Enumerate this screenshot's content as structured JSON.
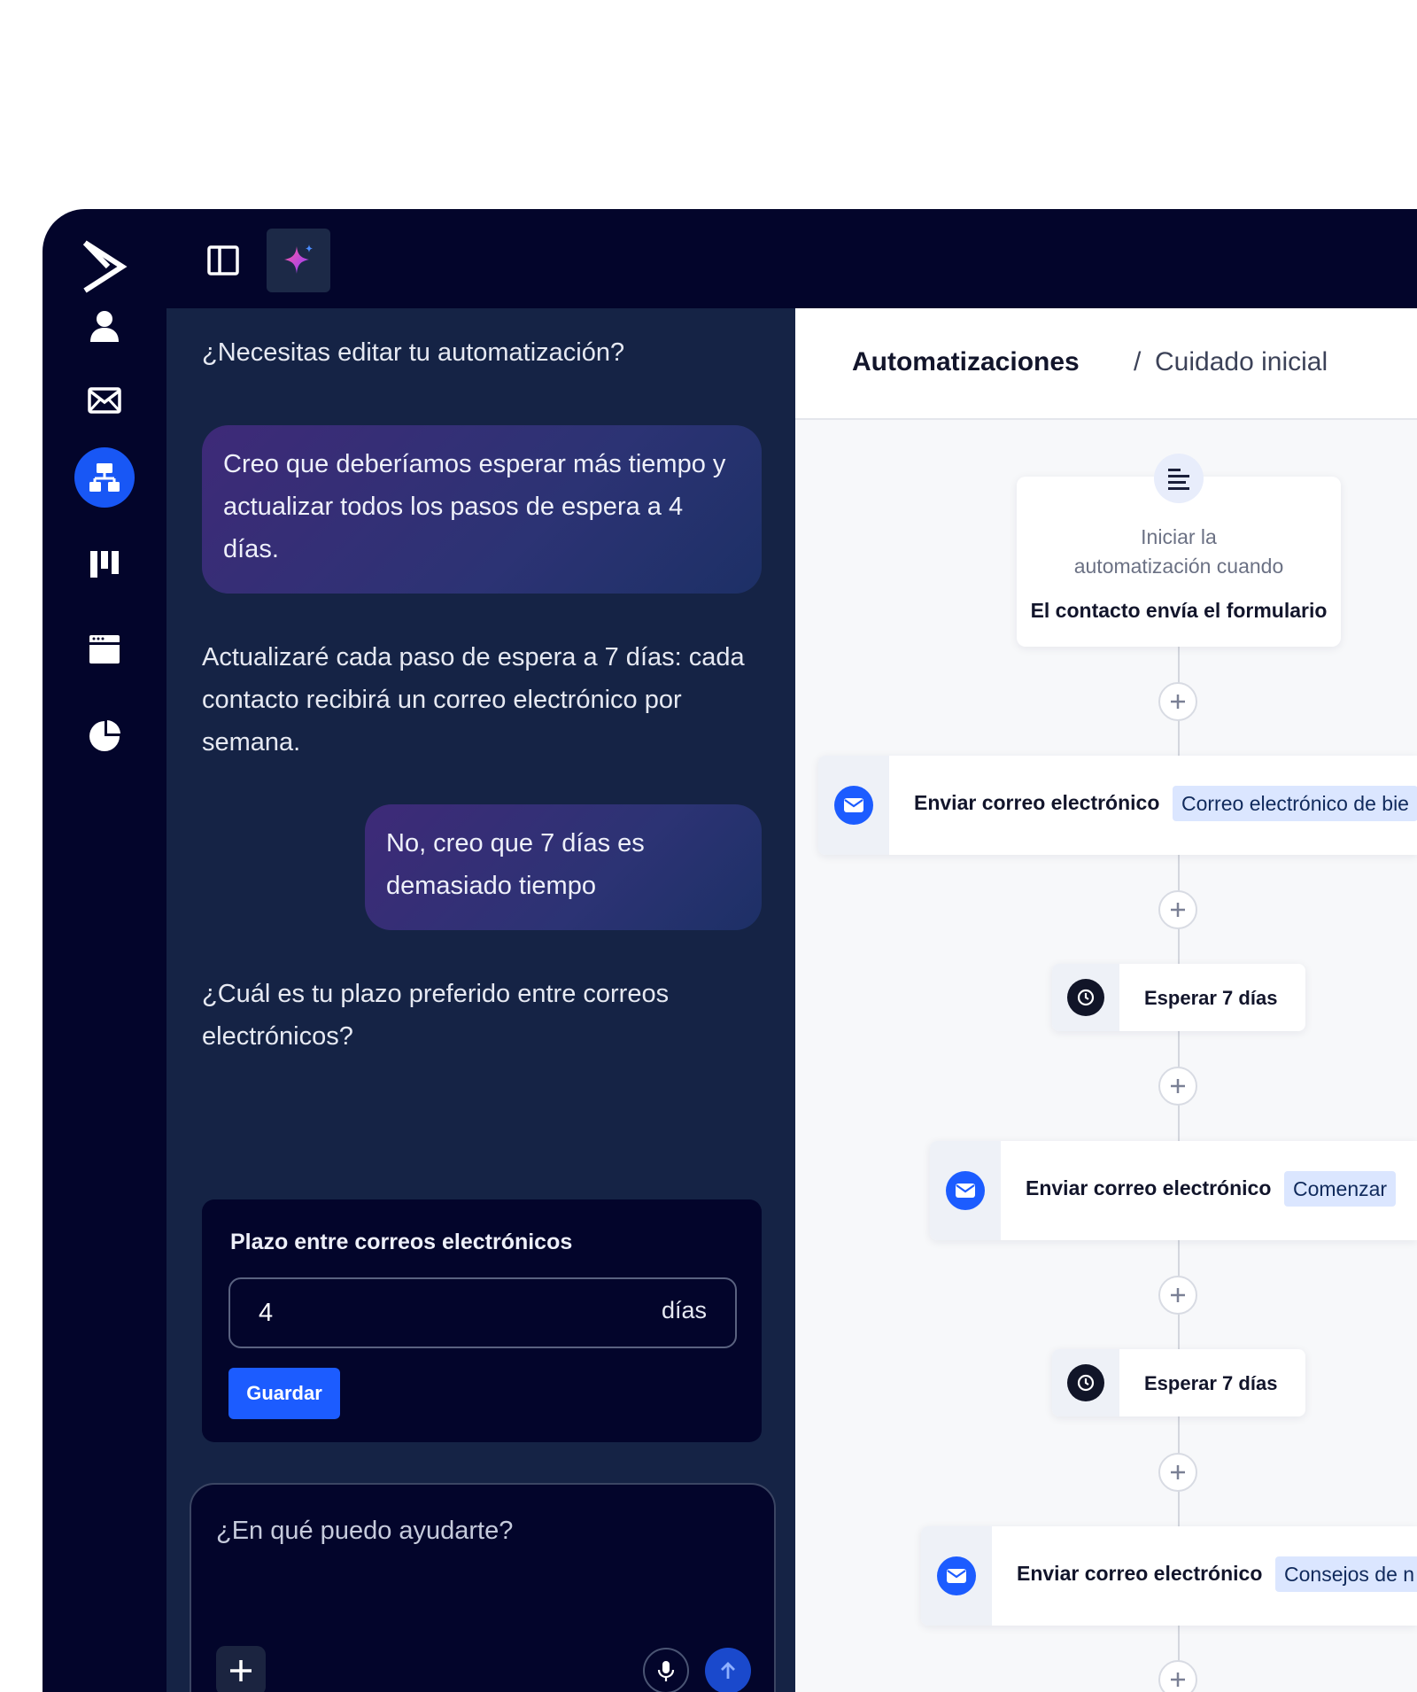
{
  "chat": {
    "question1": "¿Necesitas editar tu automatización?",
    "user_msg1": "Creo que deberíamos esperar más tiempo y actualizar todos los pasos de espera a 4 días.",
    "ai_msg2": "Actualizaré cada paso de espera a 7 días: cada contacto recibirá un correo electrónico por semana.",
    "user_msg2": "No, creo que 7 días es demasiado tiempo",
    "ai_msg3": "¿Cuál es tu plazo preferido entre correos electrónicos?",
    "form": {
      "label": "Plazo entre correos electrónicos",
      "value": "4",
      "unit": "días",
      "save_label": "Guardar"
    },
    "composer_placeholder": "¿En qué puedo ayudarte?"
  },
  "breadcrumb": {
    "root": "Automatizaciones",
    "separator": "/",
    "current": "Cuidado inicial"
  },
  "workflow": {
    "trigger_line1": "Iniciar la automatización cuando",
    "trigger_line2": "El contacto envía el formulario",
    "step1_label": "Enviar correo electrónico",
    "step1_tag": "Correo electrónico de bie",
    "wait1_label": "Esperar 7 días",
    "step2_label": "Enviar correo electrónico",
    "step2_tag": "Comenzar",
    "wait2_label": "Esperar 7 días",
    "step3_label": "Enviar correo electrónico",
    "step3_tag": "Consejos de n"
  },
  "colors": {
    "app_bg": "#03052b",
    "chat_bg": "#152345",
    "accent_blue": "#1c5cff",
    "ai_sparkle": "#e0408a"
  },
  "icons": {
    "logo": "chevron-logo-icon",
    "nav": [
      "contacts-icon",
      "mail-icon",
      "automation-icon",
      "pipeline-icon",
      "website-icon",
      "reports-icon"
    ],
    "topbar": [
      "sidebar-toggle-icon",
      "ai-sparkle-icon"
    ]
  }
}
